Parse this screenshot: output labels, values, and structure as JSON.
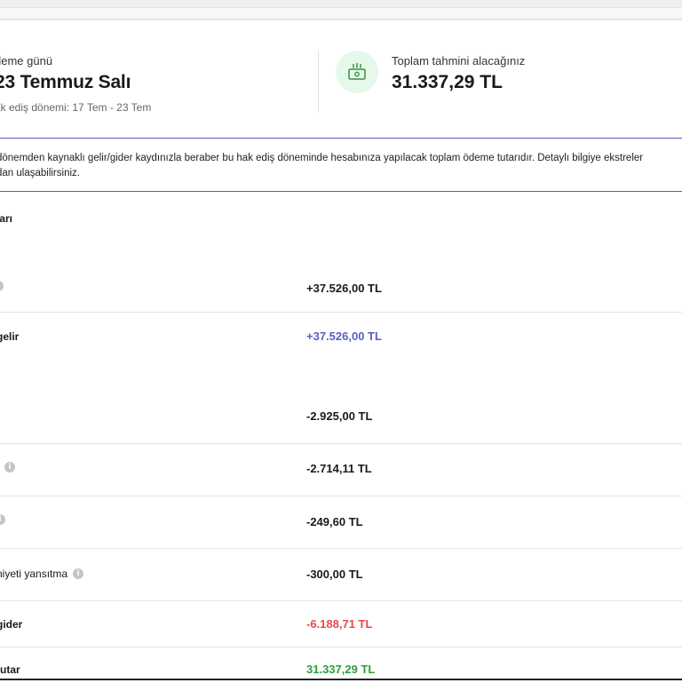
{
  "summary": {
    "payment_day_label": "deme günü",
    "payment_date": "23 Temmuz Salı",
    "period": "ak ediş dönemi: 17 Tem - 23 Tem",
    "total_label": "Toplam tahmini alacağınız",
    "total_value": "31.337,29 TL",
    "icon": "money-icon"
  },
  "info_text_line1": "dönemden kaynaklı gelir/gider kaydınızla beraber bu hak ediş döneminde hesabınıza yapılacak toplam ödeme tutarıdır. Detaylı bilgiye ekstreler",
  "info_text_line2": "dan ulaşabilirsiniz.",
  "section_title": "ları",
  "rows": [
    {
      "label": "",
      "value": "+37.526,00 TL"
    },
    {
      "label": "gelir",
      "value": "+37.526,00 TL"
    },
    {
      "label": "",
      "value": "-2.925,00 TL"
    },
    {
      "label": "",
      "value": "-2.714,11 TL"
    },
    {
      "label": "",
      "value": "-249,60 TL"
    },
    {
      "label": "niyeti yansıtma",
      "value": "-300,00 TL"
    },
    {
      "label": "gider",
      "value": "-6.188,71 TL"
    },
    {
      "label": "tutar",
      "value": "31.337,29 TL"
    }
  ],
  "colors": {
    "accent_purple": "#5a5fc0",
    "negative_red": "#e84a4a",
    "positive_green": "#2e9e3a",
    "icon_bg": "#e6f8ea"
  }
}
